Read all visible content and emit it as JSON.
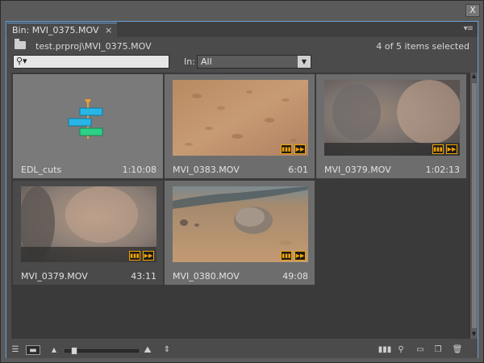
{
  "window": {
    "close_label": "X"
  },
  "tab": {
    "title": "Bin: MVI_0375.MOV",
    "close": "×"
  },
  "path": {
    "text": "test.prproj\\MVI_0375.MOV",
    "selection": "4 of 5 items selected"
  },
  "filter": {
    "search_value": "",
    "in_label": "In:",
    "in_value": "All"
  },
  "zoom": {
    "level": 0.08
  },
  "items": [
    {
      "name": "EDL_cuts",
      "duration": "1:10:08",
      "selected": true,
      "type": "sequence"
    },
    {
      "name": "MVI_0383.MOV",
      "duration": "6:01",
      "selected": true,
      "type": "clip"
    },
    {
      "name": "MVI_0379.MOV",
      "duration": "1:02:13",
      "selected": true,
      "type": "clip"
    },
    {
      "name": "MVI_0379.MOV",
      "duration": "43:11",
      "selected": false,
      "type": "clip"
    },
    {
      "name": "MVI_0380.MOV",
      "duration": "49:08",
      "selected": true,
      "type": "clip"
    }
  ],
  "colors": {
    "accent": "#6aa0d8",
    "badge": "#f0a300",
    "seq_orange": "#f0a030",
    "seq_blue": "#29b6e6",
    "seq_green": "#2ecf86"
  }
}
